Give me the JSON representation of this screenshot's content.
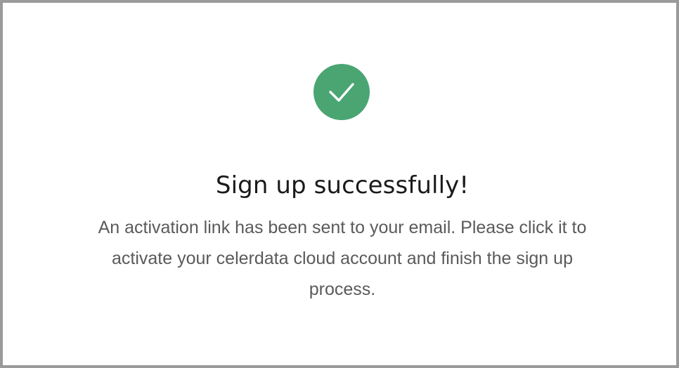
{
  "dialog": {
    "icon": "check-circle-icon",
    "accent_color": "#4aa573",
    "title": "Sign up successfully!",
    "message": "An activation link has been sent to your email. Please click it to activate your celerdata cloud account and finish the sign up process."
  }
}
